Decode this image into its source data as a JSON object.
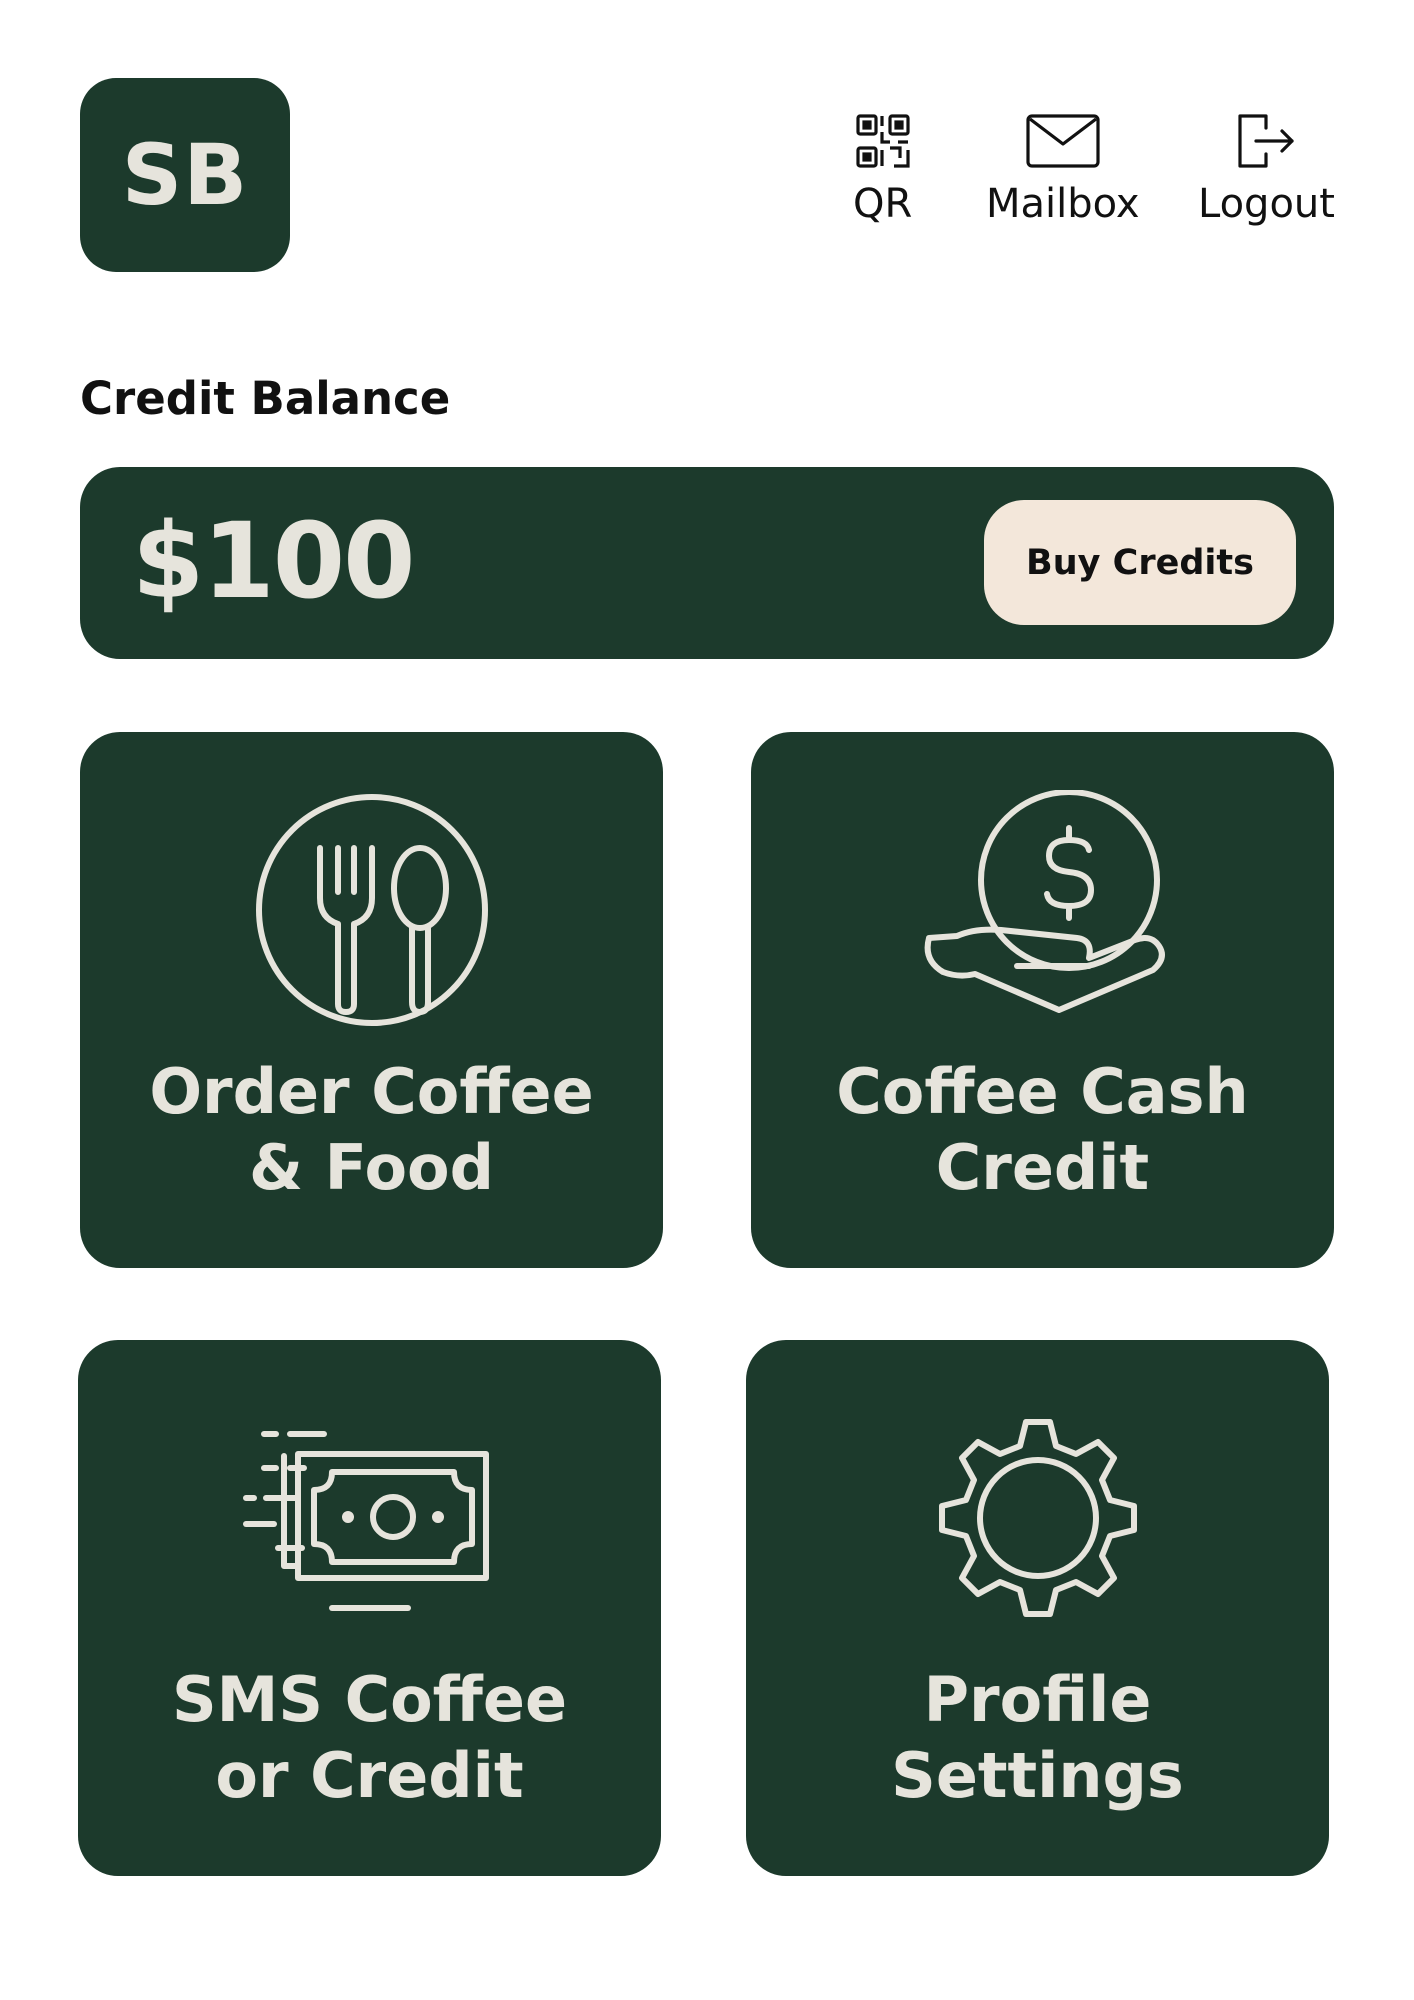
{
  "header": {
    "avatar_initials": "SB",
    "actions": [
      {
        "label": "QR",
        "icon": "qr-code-icon"
      },
      {
        "label": "Mailbox",
        "icon": "envelope-icon"
      },
      {
        "label": "Logout",
        "icon": "logout-icon"
      }
    ]
  },
  "balance": {
    "title": "Credit Balance",
    "amount": "$100",
    "buy_label": "Buy Credits"
  },
  "tiles": [
    {
      "line1": "Order Coffee",
      "line2": "& Food",
      "icon": "fork-spoon-icon"
    },
    {
      "line1": "Coffee Cash",
      "line2": "Credit",
      "icon": "hand-coin-icon"
    },
    {
      "line1": "SMS Coffee",
      "line2": "or Credit",
      "icon": "money-transfer-icon"
    },
    {
      "line1": "Profile",
      "line2": "Settings",
      "icon": "gear-icon"
    }
  ],
  "colors": {
    "primary_green": "#1c3a2c",
    "text_light": "#e6e4dc",
    "button_cream": "#f3e7da",
    "text_dark": "#111111"
  }
}
